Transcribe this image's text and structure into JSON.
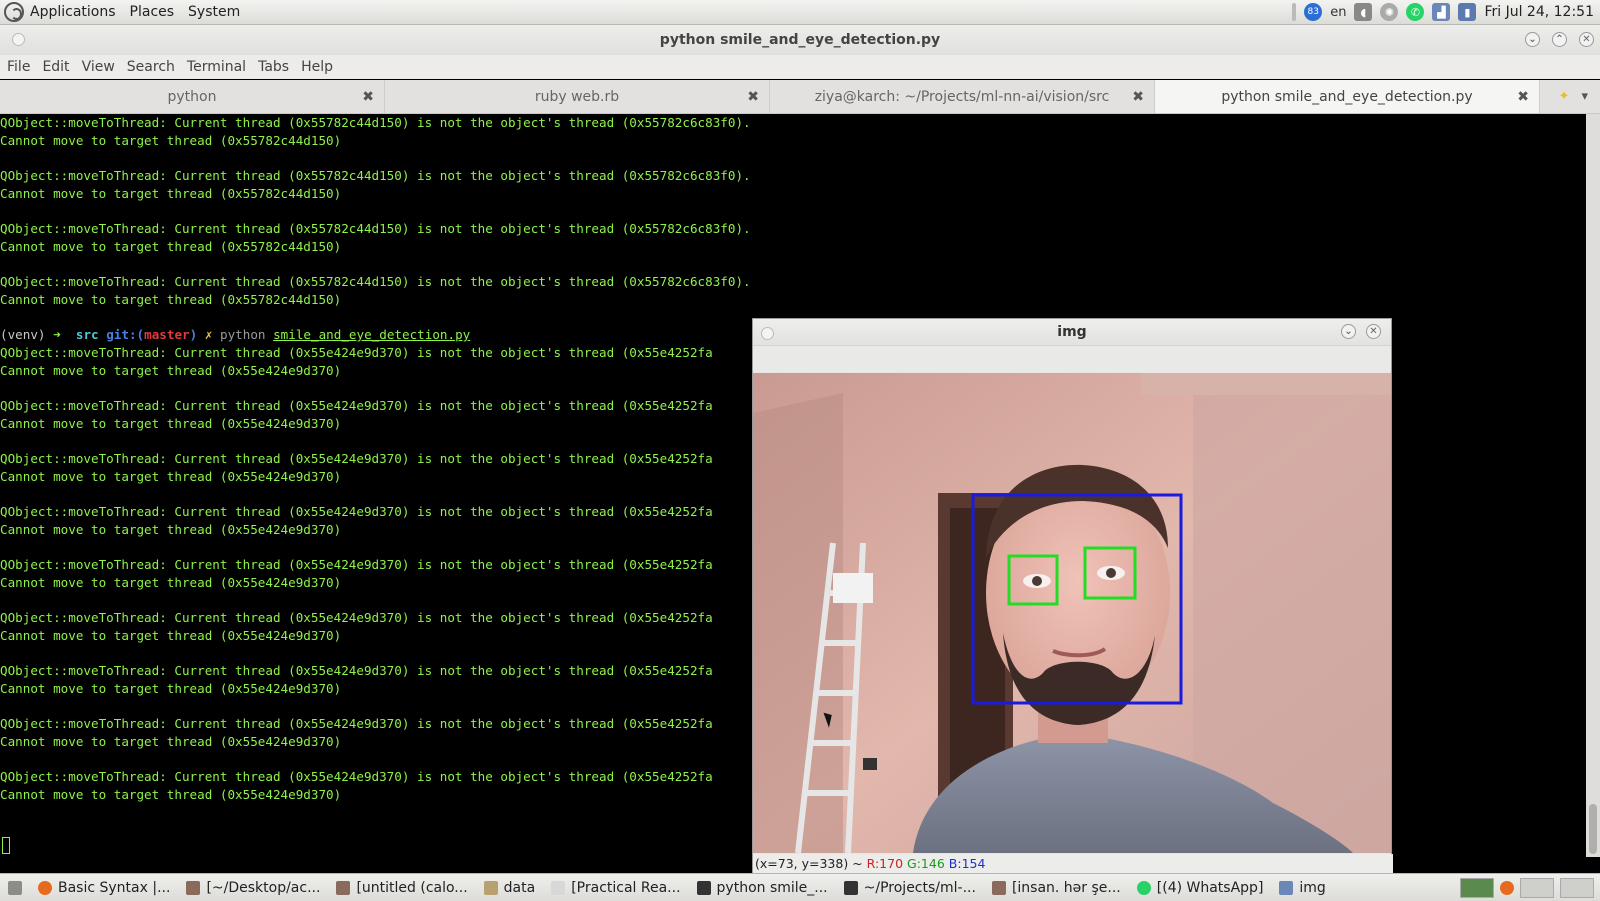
{
  "top_panel": {
    "menus": [
      "Applications",
      "Places",
      "System"
    ],
    "notification_count": "83",
    "keyboard_layout": "en",
    "clock": "Fri Jul 24, 12:51"
  },
  "terminal": {
    "title": "python smile_and_eye_detection.py",
    "menu": [
      "File",
      "Edit",
      "View",
      "Search",
      "Terminal",
      "Tabs",
      "Help"
    ],
    "tabs": [
      {
        "label": "python"
      },
      {
        "label": "ruby web.rb"
      },
      {
        "label": "ziya@karch: ~/Projects/ml-nn-ai/vision/src"
      },
      {
        "label": "python smile_and_eye_detection.py"
      }
    ],
    "prompt": {
      "venv": "(venv)",
      "arrow": "➜",
      "dir": "src",
      "git": "git:(",
      "branch": "master",
      "git_close": ")",
      "dirty": "✗",
      "command": "python",
      "file": "smile_and_eye_detection.py"
    },
    "lines_before": [
      "QObject::moveToThread: Current thread (0x55782c44d150) is not the object's thread (0x55782c6c83f0).",
      "Cannot move to target thread (0x55782c44d150)",
      "",
      "QObject::moveToThread: Current thread (0x55782c44d150) is not the object's thread (0x55782c6c83f0).",
      "Cannot move to target thread (0x55782c44d150)",
      "",
      "QObject::moveToThread: Current thread (0x55782c44d150) is not the object's thread (0x55782c6c83f0).",
      "Cannot move to target thread (0x55782c44d150)",
      "",
      "QObject::moveToThread: Current thread (0x55782c44d150) is not the object's thread (0x55782c6c83f0).",
      "Cannot move to target thread (0x55782c44d150)",
      ""
    ],
    "lines_after": [
      "QObject::moveToThread: Current thread (0x55e424e9d370) is not the object's thread (0x55e4252fa",
      "Cannot move to target thread (0x55e424e9d370)",
      "",
      "QObject::moveToThread: Current thread (0x55e424e9d370) is not the object's thread (0x55e4252fa",
      "Cannot move to target thread (0x55e424e9d370)",
      "",
      "QObject::moveToThread: Current thread (0x55e424e9d370) is not the object's thread (0x55e4252fa",
      "Cannot move to target thread (0x55e424e9d370)",
      "",
      "QObject::moveToThread: Current thread (0x55e424e9d370) is not the object's thread (0x55e4252fa",
      "Cannot move to target thread (0x55e424e9d370)",
      "",
      "QObject::moveToThread: Current thread (0x55e424e9d370) is not the object's thread (0x55e4252fa",
      "Cannot move to target thread (0x55e424e9d370)",
      "",
      "QObject::moveToThread: Current thread (0x55e424e9d370) is not the object's thread (0x55e4252fa",
      "Cannot move to target thread (0x55e424e9d370)",
      "",
      "QObject::moveToThread: Current thread (0x55e424e9d370) is not the object's thread (0x55e4252fa",
      "Cannot move to target thread (0x55e424e9d370)",
      "",
      "QObject::moveToThread: Current thread (0x55e424e9d370) is not the object's thread (0x55e4252fa",
      "Cannot move to target thread (0x55e424e9d370)",
      "",
      "QObject::moveToThread: Current thread (0x55e424e9d370) is not the object's thread (0x55e4252fa",
      "Cannot move to target thread (0x55e424e9d370)"
    ]
  },
  "img_window": {
    "title": "img",
    "status_coords": "(x=73, y=338) ~",
    "status_r": "R:170",
    "status_g": "G:146",
    "status_b": "B:154",
    "face_box_color": "#1a1ae0",
    "eye_box_color": "#22dd22"
  },
  "taskbar": {
    "items": [
      {
        "label": "Basic Syntax |...",
        "icon": "firefox-icon"
      },
      {
        "label": "[~/Desktop/ac...",
        "icon": "editor-icon"
      },
      {
        "label": "[untitled (calo...",
        "icon": "editor-icon"
      },
      {
        "label": "data",
        "icon": "folder-icon"
      },
      {
        "label": "[Practical Rea...",
        "icon": "document-icon"
      },
      {
        "label": "python smile_...",
        "icon": "terminal-icon"
      },
      {
        "label": "~/Projects/ml-...",
        "icon": "terminal-icon"
      },
      {
        "label": "[insan. hər şe...",
        "icon": "editor-icon"
      },
      {
        "label": "[(4) WhatsApp]",
        "icon": "whatsapp-icon"
      },
      {
        "label": "img",
        "icon": "window-icon"
      }
    ]
  }
}
